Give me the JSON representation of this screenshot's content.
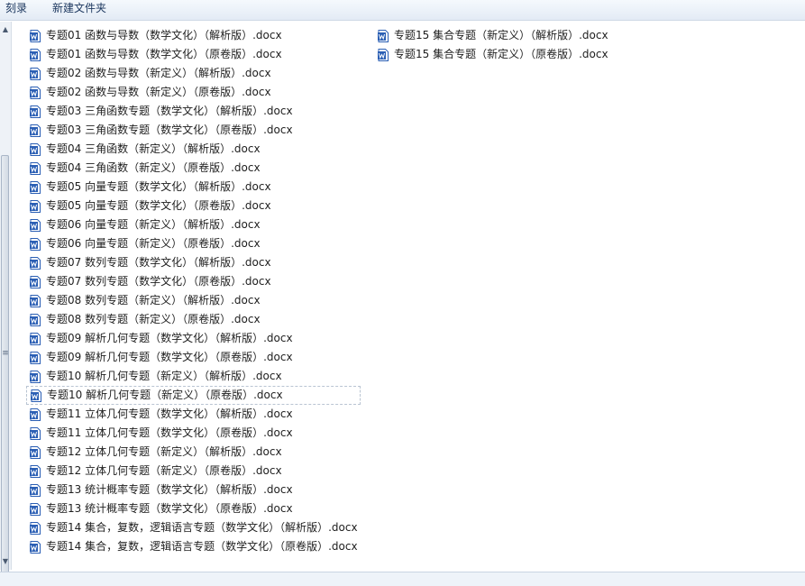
{
  "toolbar": {
    "burn_label": "刻录",
    "new_folder_label": "新建文件夹"
  },
  "files_col1": [
    "专题01 函数与导数（数学文化）（解析版）.docx",
    "专题01 函数与导数（数学文化）（原卷版）.docx",
    "专题02 函数与导数（新定义）（解析版）.docx",
    "专题02 函数与导数（新定义）（原卷版）.docx",
    "专题03 三角函数专题（数学文化）（解析版）.docx",
    "专题03 三角函数专题（数学文化）（原卷版）.docx",
    "专题04 三角函数（新定义）（解析版）.docx",
    "专题04 三角函数（新定义）（原卷版）.docx",
    "专题05 向量专题（数学文化）（解析版）.docx",
    "专题05 向量专题（数学文化）（原卷版）.docx",
    "专题06 向量专题（新定义）（解析版）.docx",
    "专题06 向量专题（新定义）（原卷版）.docx",
    "专题07 数列专题（数学文化）（解析版）.docx",
    "专题07 数列专题（数学文化）（原卷版）.docx",
    "专题08 数列专题（新定义）（解析版）.docx",
    "专题08 数列专题（新定义）（原卷版）.docx",
    "专题09 解析几何专题（数学文化）（解析版）.docx",
    "专题09 解析几何专题（数学文化）（原卷版）.docx",
    "专题10 解析几何专题（新定义）（解析版）.docx",
    "专题10 解析几何专题（新定义）（原卷版）.docx",
    "专题11 立体几何专题（数学文化）（解析版）.docx",
    "专题11 立体几何专题（数学文化）（原卷版）.docx",
    "专题12 立体几何专题（新定义）（解析版）.docx",
    "专题12 立体几何专题（新定义）（原卷版）.docx",
    "专题13 统计概率专题（数学文化）（解析版）.docx",
    "专题13 统计概率专题（数学文化）（原卷版）.docx",
    "专题14 集合，复数，逻辑语言专题（数学文化）（解析版）.docx",
    "专题14 集合，复数，逻辑语言专题（数学文化）（原卷版）.docx"
  ],
  "files_col2": [
    "专题15 集合专题（新定义）（解析版）.docx",
    "专题15 集合专题（新定义）（原卷版）.docx"
  ],
  "selected_index_col1": 19,
  "icon": "word-doc-icon",
  "colors": {
    "word_blue": "#2b5fb4",
    "toolbar_text": "#1e3960",
    "selection_border": "#b9c4d2"
  }
}
